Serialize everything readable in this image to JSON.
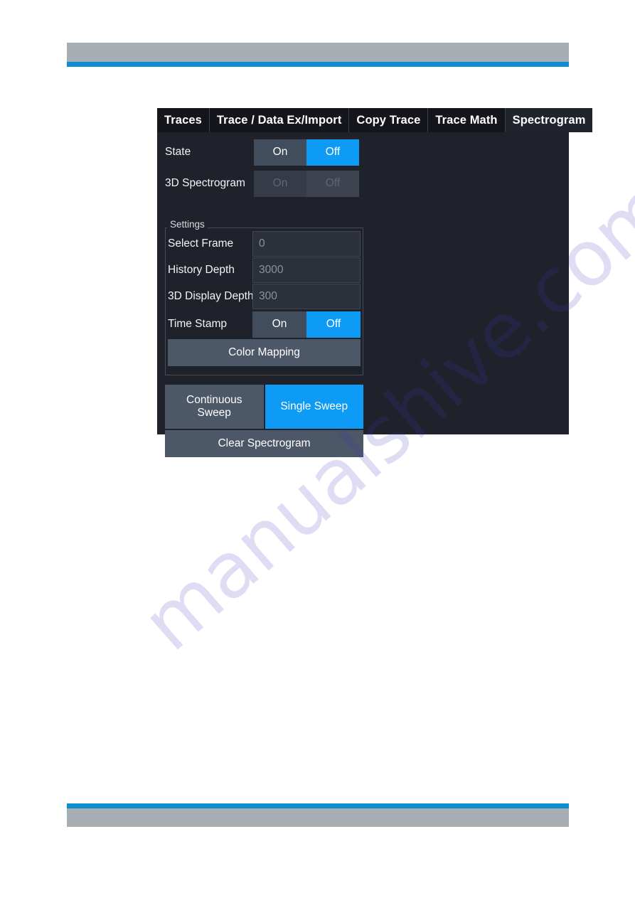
{
  "page": {
    "watermark": "manualshive.com",
    "header_color": "#a6aeb4",
    "rule_color": "#0d8ecf"
  },
  "dialog": {
    "tabs": [
      {
        "label": "Traces",
        "active": false
      },
      {
        "label": "Trace / Data Ex/Import",
        "active": false
      },
      {
        "label": "Copy Trace",
        "active": false
      },
      {
        "label": "Trace Math",
        "active": false
      },
      {
        "label": "Spectrogram",
        "active": true
      }
    ],
    "rows": {
      "state": {
        "label": "State",
        "on_label": "On",
        "off_label": "Off",
        "selected": "Off",
        "enabled": true
      },
      "spectrogram_3d": {
        "label": "3D Spectrogram",
        "on_label": "On",
        "off_label": "Off",
        "selected": "Off",
        "enabled": false
      }
    },
    "settings": {
      "title": "Settings",
      "select_frame": {
        "label": "Select Frame",
        "value": "0"
      },
      "history_depth": {
        "label": "History Depth",
        "value": "3000"
      },
      "display_depth_3d": {
        "label": "3D Display Depth",
        "value": "300"
      },
      "time_stamp": {
        "label": "Time Stamp",
        "on_label": "On",
        "off_label": "Off",
        "selected": "Off"
      },
      "color_mapping_label": "Color Mapping"
    },
    "buttons": {
      "continuous_sweep": "Continuous\nSweep",
      "continuous_sweep_line1": "Continuous",
      "continuous_sweep_line2": "Sweep",
      "single_sweep": "Single Sweep",
      "clear_spectrogram": "Clear Spectrogram"
    },
    "colors": {
      "accent": "#0d9bf5",
      "panel": "#1f222a",
      "tab": "#14161c",
      "button": "#4c5767",
      "field": "#2b303a"
    }
  }
}
